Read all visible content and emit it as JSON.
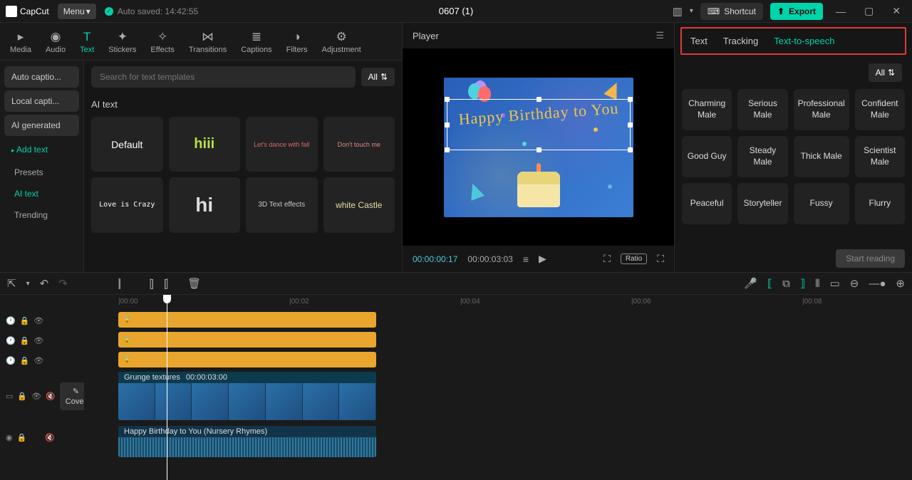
{
  "app": {
    "name": "CapCut",
    "menu": "Menu",
    "autosave": "Auto saved: 14:42:55",
    "title": "0607 (1)"
  },
  "titlebar": {
    "shortcut": "Shortcut",
    "export": "Export"
  },
  "toolTabs": [
    {
      "label": "Media"
    },
    {
      "label": "Audio"
    },
    {
      "label": "Text"
    },
    {
      "label": "Stickers"
    },
    {
      "label": "Effects"
    },
    {
      "label": "Transitions"
    },
    {
      "label": "Captions"
    },
    {
      "label": "Filters"
    },
    {
      "label": "Adjustment"
    }
  ],
  "sidebar": {
    "pills": [
      "Auto captio...",
      "Local capti...",
      "AI generated"
    ],
    "addText": "Add text",
    "subs": [
      "Presets",
      "AI text",
      "Trending"
    ]
  },
  "templates": {
    "searchPlaceholder": "Search for text templates",
    "all": "All",
    "section": "AI text",
    "items": [
      "Default",
      "hiii",
      "Let's dance with fall",
      "Don't touch me",
      "Love is Crazy",
      "hi",
      "3D Text effects",
      "white Castle"
    ]
  },
  "player": {
    "label": "Player",
    "canvasText": "Happy Birthday to You",
    "cur": "00:00:00:17",
    "dur": "00:00:03:03",
    "ratio": "Ratio"
  },
  "right": {
    "tabs": [
      "Text",
      "Tracking",
      "Text-to-speech"
    ],
    "all": "All",
    "voices": [
      "Charming Male",
      "Serious Male",
      "Professional Male",
      "Confident Male",
      "Good Guy",
      "Steady Male",
      "Thick Male",
      "Scientist Male",
      "Peaceful",
      "Storyteller",
      "Fussy",
      "Flurry"
    ],
    "start": "Start reading"
  },
  "timeline": {
    "ticks": [
      "|00:00",
      "|00:02",
      "|00:04",
      "|00:06",
      "|00:08"
    ],
    "videoClip": {
      "name": "Grunge textures",
      "dur": "00:00:03:00"
    },
    "audioClip": "Happy Birthday to You (Nursery Rhymes)",
    "cover": "Cover"
  }
}
